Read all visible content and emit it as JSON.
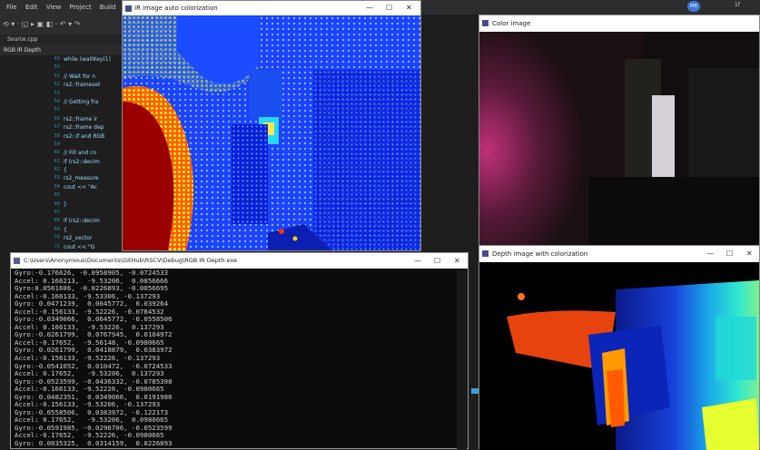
{
  "ide": {
    "menu": [
      "File",
      "Edit",
      "View",
      "Project",
      "Build"
    ],
    "toolbar_glyphs": "⟲ ▾ · ◱ ▸ ▣ ◧ · ↶ ▾ ↷",
    "tab_label": "Source.cpp",
    "breadcrumb": "RGB IR Depth",
    "user_initials": "MB",
    "top_right_text": "1f",
    "line_numbers": [
      "49",
      "50",
      "51",
      "52",
      "53",
      "54",
      "55",
      "56",
      "57",
      "58",
      "59",
      "60",
      "61",
      "62",
      "63",
      "64",
      "65",
      "66",
      "67",
      "68",
      "69",
      "70",
      "71",
      "72"
    ],
    "code_lines": [
      "while (waitKey(1)",
      "",
      "  // Wait for n",
      "  rs2::frameset",
      "",
      "  // Getting fra",
      "",
      "  rs2::frame ir",
      "  rs2::frame dep",
      "  rs2::if and RGB",
      "",
      "  // Fill and co",
      "  if (rs2::decim",
      "  {",
      "    rs2_measure",
      "    cout << \"Ac",
      "",
      "  }",
      "",
      "  if (rs2::decim",
      "  {",
      "    rs2_vector",
      "    cout << \"G",
      ""
    ]
  },
  "ir_window": {
    "title": "IR image auto colorization",
    "min": "—",
    "max": "☐",
    "close": "✕"
  },
  "color_window": {
    "title": "Color image"
  },
  "depth_window": {
    "title": "Depth image with colorization",
    "min": "—",
    "max": "☐",
    "close": "✕"
  },
  "console": {
    "title": "C:\\Users\\Anonymous\\Documents\\GitHub\\RSCV\\Debug\\RGB IR Depth.exe",
    "min": "—",
    "max": "☐",
    "close": "✕",
    "lines": [
      "Gyro:-0.176626, -0.0958905, -0.0724533",
      "Accel: 0.166213,  -9.53206,  0.0856666",
      "Gyro:0.0561606, -0.0226893, -0.0056695",
      "Accel:-0.166133, -9.53306, -0.137293",
      "Gyro: 0.0471239,  0.0645772,  0.039264",
      "Accel:-0.156133, -9.52226, -0.0784532",
      "Gyro:-0.0349066,  0.0645772, -0.0558506",
      "Accel: 0.166133,  -9.53226,  0.137293",
      "Gyro:-0.0261799,  0.0767945,  0.0104972",
      "Accel:-0.17652,  -9.56148, -0.0980665",
      "Gyro: 0.0261799,  0.0418879,  0.0383972",
      "Accel:-0.156133, -9.52226, -0.137293",
      "Gyro:-0.0541052,  0.010472,  -0.0724533",
      "Accel: 0.17652,   -9.53206,  0.137293",
      "Gyro:-0.0523599, -0.0436332, -0.0785398",
      "Accel:-0.166133, -9.52226, -0.0980665",
      "Gyro: 0.0482351,  0.0349066,  0.0191986",
      "Accel:-0.156133, -9.53206, -0.137293",
      "Gyro:-0.0558506,  0.0383972, -0.122173",
      "Accel: 0.17652,   -9.53206,  0.0980665",
      "Gyro:-0.0591985, -0.0296706, -0.0523599",
      "Accel:-0.17652,  -9.52226, -0.0980665",
      "Gyro: 0.0035325,  0.0314159,  0.0226893"
    ]
  },
  "colors": {
    "ide_bg": "#1e1e1e",
    "console_bg": "#0c0c0c",
    "accent_blue": "#3c78d8"
  }
}
